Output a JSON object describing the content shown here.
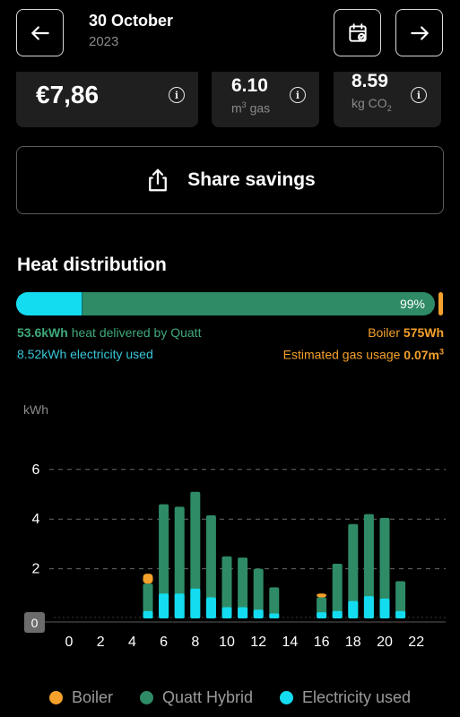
{
  "header": {
    "date_title": "30 October",
    "date_year": "2023",
    "back_icon": "arrow-left-icon",
    "calendar_icon": "calendar-icon",
    "forward_icon": "arrow-right-icon"
  },
  "summary": {
    "savings": "€7,86",
    "gas_value": "6.10",
    "gas_unit_prefix": "m",
    "gas_unit_sup": "3",
    "gas_unit_suffix": " gas",
    "co2_value": "8.59",
    "co2_unit_prefix": "kg CO",
    "co2_unit_sub": "2"
  },
  "share": {
    "label": "Share savings",
    "icon": "share-icon"
  },
  "heat": {
    "title": "Heat distribution",
    "percent_label": "99%",
    "electricity_fraction": 0.158,
    "heat_value": "53.6kWh",
    "heat_text": " heat delivered by Quatt",
    "electricity_text": "8.52kWh electricity used",
    "boiler_label": "Boiler ",
    "boiler_value": "575Wh",
    "gas_label": "Estimated gas usage ",
    "gas_value": "0.07m",
    "gas_sup": "3"
  },
  "colors": {
    "boiler": "#f5a12b",
    "quatt": "#2e8b66",
    "electricity": "#14dcf0",
    "heat_text": "#3fa97a",
    "electricity_text": "#38c7d8",
    "boiler_text": "#f5a12b"
  },
  "chart_data": {
    "type": "bar",
    "ylabel": "kWh",
    "y_ticks": [
      "0",
      "2",
      "4",
      "6"
    ],
    "x_ticks": [
      "0",
      "2",
      "4",
      "6",
      "8",
      "10",
      "12",
      "14",
      "16",
      "18",
      "20",
      "22"
    ],
    "ylim": [
      0,
      6.5
    ],
    "xlim": [
      0,
      23
    ],
    "grid": true,
    "legend_position": "bottom",
    "series": [
      {
        "name": "Boiler",
        "x": [
          5,
          16
        ],
        "values": [
          0.4,
          0.15
        ]
      },
      {
        "name": "Quatt Hybrid",
        "x": [
          5,
          6,
          7,
          8,
          9,
          10,
          11,
          12,
          13,
          16,
          17,
          18,
          19,
          20,
          21
        ],
        "values": [
          1.4,
          4.6,
          4.5,
          5.1,
          4.15,
          2.5,
          2.45,
          2.0,
          1.25,
          0.85,
          2.2,
          3.8,
          4.2,
          4.05,
          1.5
        ]
      },
      {
        "name": "Electricity used",
        "x": [
          5,
          6,
          7,
          8,
          9,
          10,
          11,
          12,
          13,
          16,
          17,
          18,
          19,
          20,
          21
        ],
        "values": [
          0.3,
          1.0,
          1.0,
          1.2,
          0.85,
          0.45,
          0.45,
          0.35,
          0.2,
          0.25,
          0.3,
          0.7,
          0.9,
          0.8,
          0.3
        ]
      }
    ]
  },
  "legend": {
    "boiler": "Boiler",
    "quatt": "Quatt Hybrid",
    "electricity": "Electricity used"
  }
}
